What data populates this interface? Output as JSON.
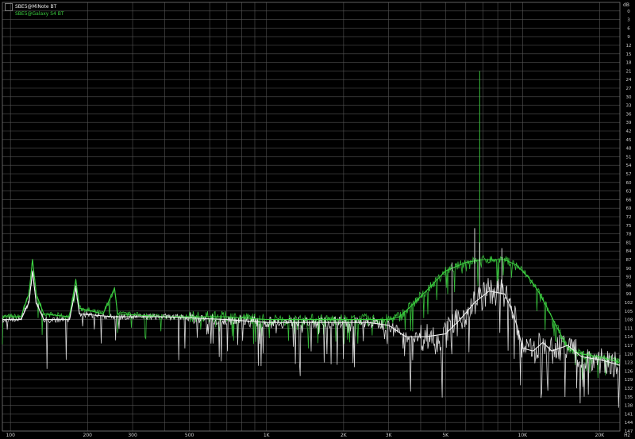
{
  "chart_data": {
    "type": "line",
    "title": "",
    "xlabel": "",
    "ylabel": "",
    "x_unit": "Hz",
    "y_unit": "dB",
    "x_scale": "log",
    "xlim": [
      93,
      24000
    ],
    "ylim": [
      -147,
      3
    ],
    "grid": true,
    "legend_position": "top-left",
    "x_ticks": [
      {
        "value": 100,
        "label": "100"
      },
      {
        "value": 200,
        "label": "200"
      },
      {
        "value": 300,
        "label": "300"
      },
      {
        "value": 500,
        "label": "500"
      },
      {
        "value": 1000,
        "label": "1K"
      },
      {
        "value": 2000,
        "label": "2K"
      },
      {
        "value": 3000,
        "label": "3K"
      },
      {
        "value": 5000,
        "label": "5K"
      },
      {
        "value": 10000,
        "label": "10K"
      },
      {
        "value": 20000,
        "label": "20K"
      }
    ],
    "y_ticks": [
      0,
      -3,
      -6,
      -9,
      -12,
      -15,
      -18,
      -21,
      -24,
      -27,
      -30,
      -33,
      -36,
      -39,
      -42,
      -45,
      -48,
      -51,
      -54,
      -57,
      -60,
      -63,
      -66,
      -69,
      -72,
      -75,
      -78,
      -81,
      -84,
      -87,
      -90,
      -93,
      -96,
      -99,
      -102,
      -105,
      -108,
      -111,
      -114,
      -117,
      -120,
      -123,
      -126,
      -129,
      -132,
      -135,
      -138,
      -141,
      -144,
      -147
    ],
    "series": [
      {
        "name": "SBE5@MiNote BT",
        "color": "#f2f2f2",
        "points": [
          [
            93,
            -108
          ],
          [
            110,
            -108
          ],
          [
            118,
            -102
          ],
          [
            122,
            -91
          ],
          [
            126,
            -102
          ],
          [
            135,
            -108
          ],
          [
            170,
            -108
          ],
          [
            180,
            -97
          ],
          [
            186,
            -106
          ],
          [
            250,
            -107
          ],
          [
            400,
            -107
          ],
          [
            700,
            -108
          ],
          [
            1000,
            -109
          ],
          [
            1500,
            -109
          ],
          [
            2000,
            -109
          ],
          [
            2500,
            -109
          ],
          [
            3000,
            -110
          ],
          [
            3500,
            -114
          ],
          [
            4200,
            -114
          ],
          [
            5000,
            -113
          ],
          [
            5700,
            -108
          ],
          [
            6500,
            -102
          ],
          [
            7400,
            -98
          ],
          [
            8500,
            -99
          ],
          [
            9000,
            -104
          ],
          [
            9500,
            -110
          ],
          [
            10000,
            -118
          ],
          [
            11000,
            -119
          ],
          [
            12000,
            -116
          ],
          [
            13000,
            -119
          ],
          [
            15000,
            -117
          ],
          [
            17000,
            -121
          ],
          [
            20000,
            -122
          ],
          [
            22000,
            -123
          ],
          [
            24000,
            -124
          ]
        ]
      },
      {
        "name": "SBE5@Galaxy S4 BT",
        "color": "#3cd040",
        "points": [
          [
            93,
            -107
          ],
          [
            110,
            -107
          ],
          [
            118,
            -99
          ],
          [
            122,
            -87
          ],
          [
            126,
            -99
          ],
          [
            135,
            -106
          ],
          [
            170,
            -107
          ],
          [
            180,
            -94
          ],
          [
            186,
            -104
          ],
          [
            230,
            -106
          ],
          [
            255,
            -97
          ],
          [
            262,
            -106
          ],
          [
            400,
            -107
          ],
          [
            700,
            -107
          ],
          [
            1000,
            -108
          ],
          [
            2000,
            -108
          ],
          [
            3000,
            -108
          ],
          [
            3300,
            -107
          ],
          [
            3700,
            -103
          ],
          [
            4200,
            -98
          ],
          [
            5000,
            -91
          ],
          [
            6000,
            -88
          ],
          [
            7000,
            -87
          ],
          [
            8500,
            -87
          ],
          [
            9500,
            -89
          ],
          [
            10500,
            -93
          ],
          [
            11500,
            -98
          ],
          [
            12500,
            -104
          ],
          [
            13500,
            -110
          ],
          [
            15000,
            -118
          ],
          [
            17000,
            -120
          ],
          [
            20000,
            -121
          ],
          [
            22000,
            -122
          ],
          [
            24000,
            -123
          ]
        ]
      }
    ],
    "spikes": [
      {
        "x": 6800,
        "y": -21,
        "series": 1
      },
      {
        "x": 6500,
        "y": -76,
        "series": 0
      },
      {
        "x": 5300,
        "y": -88,
        "series": 0
      },
      {
        "x": 8300,
        "y": -83,
        "series": 0
      },
      {
        "x": 6800,
        "y": -81,
        "series": 0
      }
    ]
  },
  "legend": [
    {
      "label": "SBE5@MiNote BT",
      "color": "#f2f2f2"
    },
    {
      "label": "SBE5@Galaxy S4 BT",
      "color": "#3cd040"
    }
  ]
}
